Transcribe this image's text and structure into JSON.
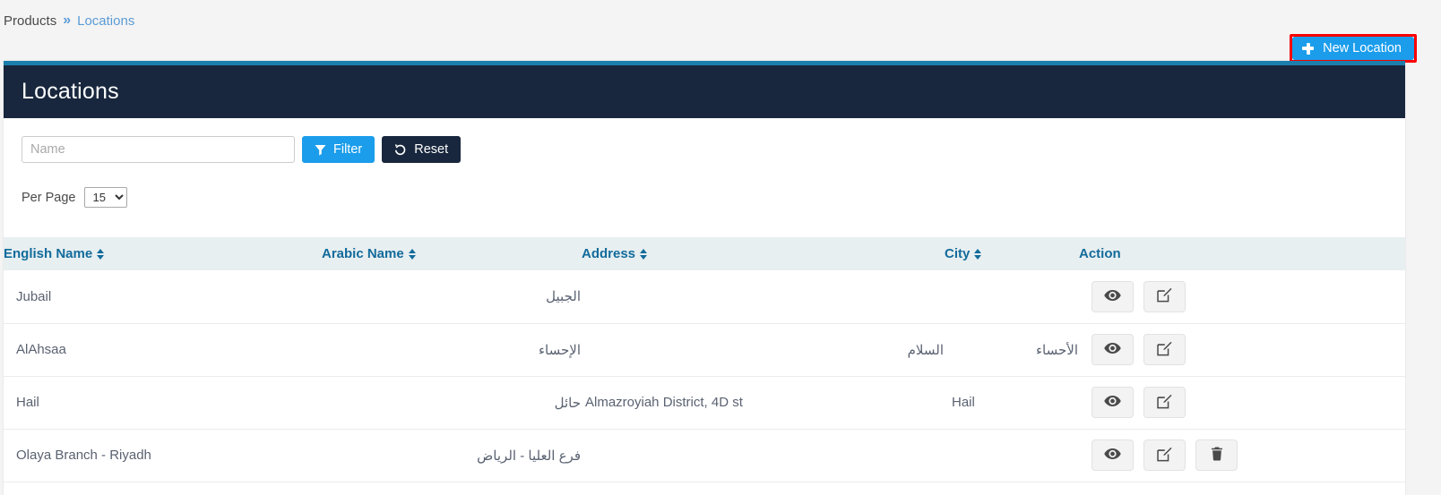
{
  "breadcrumb": {
    "parent": "Products",
    "separator": "»",
    "current": "Locations"
  },
  "toolbar": {
    "new_location_label": "New Location",
    "new_location_icon": "plus-icon",
    "highlight_color": "#fb0000",
    "accent_color": "#1b9dec"
  },
  "panel": {
    "title": "Locations",
    "header_bg": "#18273d",
    "top_border": "#1d7ead"
  },
  "filters": {
    "name_placeholder": "Name",
    "name_value": "",
    "filter_label": "Filter",
    "filter_icon": "funnel-icon",
    "reset_label": "Reset",
    "reset_icon": "undo-icon",
    "per_page_label": "Per Page",
    "per_page_value": "15",
    "per_page_options": [
      "15"
    ]
  },
  "table": {
    "columns": [
      {
        "label": "English Name",
        "sortable": true
      },
      {
        "label": "Arabic Name",
        "sortable": true
      },
      {
        "label": "Address",
        "sortable": true
      },
      {
        "label": "City",
        "sortable": true
      },
      {
        "label": "Action",
        "sortable": false
      }
    ],
    "rows": [
      {
        "english_name": "Jubail",
        "arabic_name": "الجبيل",
        "address": "",
        "city": "",
        "actions": [
          "view",
          "edit"
        ]
      },
      {
        "english_name": "AlAhsaa",
        "arabic_name": "الإحساء",
        "address": "السلام",
        "city": "الأحساء",
        "actions": [
          "view",
          "edit"
        ]
      },
      {
        "english_name": "Hail",
        "arabic_name": "حائل",
        "address": "Almazroyiah District, 4D st",
        "city": "Hail",
        "actions": [
          "view",
          "edit"
        ]
      },
      {
        "english_name": "Olaya Branch - Riyadh",
        "arabic_name": "فرع العليا - الرياض",
        "address": "",
        "city": "",
        "actions": [
          "view",
          "edit",
          "delete"
        ]
      }
    ]
  }
}
